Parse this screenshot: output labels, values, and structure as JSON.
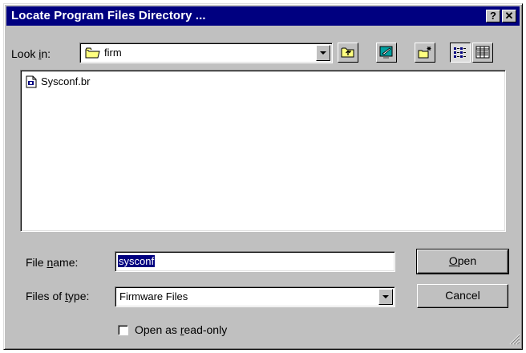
{
  "window": {
    "title": "Locate Program Files Directory ...",
    "help_label": "?",
    "close_label": "✕"
  },
  "lookin": {
    "label_pre": "Look ",
    "label_key": "i",
    "label_post": "n:",
    "value": "firm"
  },
  "toolbar": {
    "icons": [
      "up-one-level-icon",
      "desktop-icon",
      "new-folder-icon",
      "list-view-icon",
      "details-view-icon"
    ]
  },
  "files": [
    {
      "name": "Sysconf.br",
      "icon": "document-icon"
    }
  ],
  "filename": {
    "label_pre": "File ",
    "label_key": "n",
    "label_post": "ame:",
    "value": "sysconf"
  },
  "filetype": {
    "label_pre": "Files of ",
    "label_key": "t",
    "label_post": "ype:",
    "value": "Firmware Files"
  },
  "buttons": {
    "open_key": "O",
    "open_rest": "pen",
    "cancel": "Cancel"
  },
  "readonly": {
    "label_pre": "Open as ",
    "label_key": "r",
    "label_post": "ead-only",
    "checked": false
  },
  "colors": {
    "titlebar": "#000080",
    "face": "#c0c0c0",
    "selection": "#000080"
  }
}
